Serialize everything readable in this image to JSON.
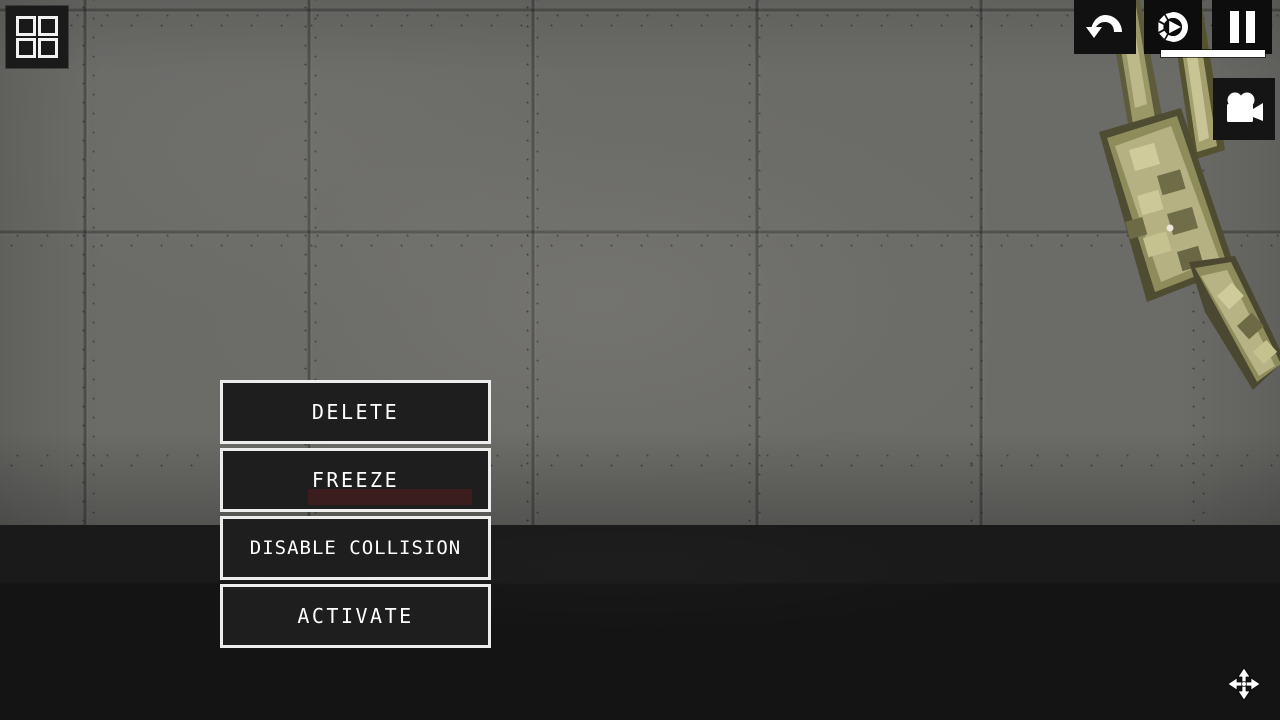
{
  "scene": {
    "wall_color": "#6b6b68",
    "floor_color": "#141414",
    "prop_color_light": "#cfcb9a",
    "prop_color_mid": "#a8a473",
    "prop_color_dark": "#5d5b3c",
    "prop_name": "pixelated-olive-limb-prop"
  },
  "hud": {
    "inventory_button": {
      "name": "inventory-grid-button",
      "icon": "grid-2x2-icon"
    },
    "top_right": {
      "undo": {
        "label": "Undo",
        "icon": "undo-arrow-icon"
      },
      "slow_motion": {
        "label": "Slow Motion",
        "icon": "slow-motion-play-icon"
      },
      "pause": {
        "label": "Pause",
        "icon": "pause-icon"
      },
      "time_bar": {
        "name": "time-scale-bar",
        "value": 100,
        "fill_color": "#ffffff"
      }
    },
    "camera_button": {
      "label": "Camera",
      "icon": "movie-camera-icon"
    },
    "cursor": {
      "name": "move-cursor",
      "icon": "four-way-move-icon"
    }
  },
  "context_menu": {
    "name": "object-context-menu",
    "buttons": [
      {
        "label": "DELETE",
        "wide": false,
        "highlighted": false
      },
      {
        "label": "FREEZE",
        "wide": false,
        "highlighted": false
      },
      {
        "label": "DISABLE COLLISION",
        "wide": true,
        "highlighted": true
      },
      {
        "label": "ACTIVATE",
        "wide": false,
        "highlighted": false
      }
    ]
  }
}
